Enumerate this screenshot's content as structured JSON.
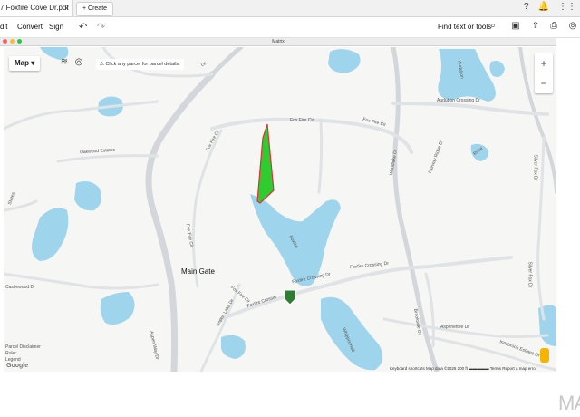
{
  "tab": {
    "title": "7 Foxfire Cove Dr.pdf",
    "close": "×"
  },
  "create_tab": {
    "label": "+ Create"
  },
  "menu": {
    "items": [
      "dit",
      "Convert",
      "Sign"
    ],
    "find_label": "Find text or tools"
  },
  "doc": {
    "title": "Matrix"
  },
  "map": {
    "type_button": "Map ▾",
    "hint": "⚠ Click any parcel for parcel details.",
    "zoom_in": "+",
    "zoom_out": "−",
    "main_gate": "Main Gate",
    "legend": [
      "Parcel Disclaimer",
      "Ruler",
      "Legend"
    ],
    "google": "Google",
    "attribution": "Keyboard shortcuts    Map data ©2025    200 ft ▬▬▬▬▬    Terms    Report a map error",
    "streets": {
      "fox_fire_cir_1": "Fox Fire Cir",
      "fox_fire_cir_2": "Fox Fire Cir",
      "fox_fire_cir_3": "Fox Fire Cir",
      "fox_fire_cir_4": "Fox Fire Cir",
      "fox_fire_cir_5": "Fox Fire Cir",
      "foxfire_crossing_1": "Foxfire Crossing Dr",
      "foxfire_crossing_2": "Foxfire Crossing Dr",
      "foxfire_crossin": "Foxfire Crossin",
      "audubon_crossing": "Audubon Crossing Dr",
      "oakwood_estates": "Oakwood Estates",
      "woodlake": "Woodlake Dr",
      "aspen_lake": "Aspen Lake Dr",
      "aspen_way": "Aspen Way Dr",
      "aspenettee": "Aspenettee Dr",
      "brookside": "Brookside Dr",
      "silver_fox_1": "Silver Fox Dr",
      "silver_fox_2": "Silver Fox Dr",
      "innsbrook": "Innsbrook Estates Dr",
      "castlewood": "Castlewood Dr",
      "states": "States",
      "le": "Le",
      "fairway": "Fairway Ridge Dr",
      "foxfire_lake": "Foxfire",
      "audubon_lake": "Audubon",
      "rose_lake": "Rose",
      "whippoorwill": "Whippoorwill"
    }
  },
  "watermark": "MA",
  "colors": {
    "water": "#9fd5ec",
    "parcel_fill": "#2ecc2e",
    "parcel_border": "#e0303a",
    "road": "#d5d8db"
  }
}
